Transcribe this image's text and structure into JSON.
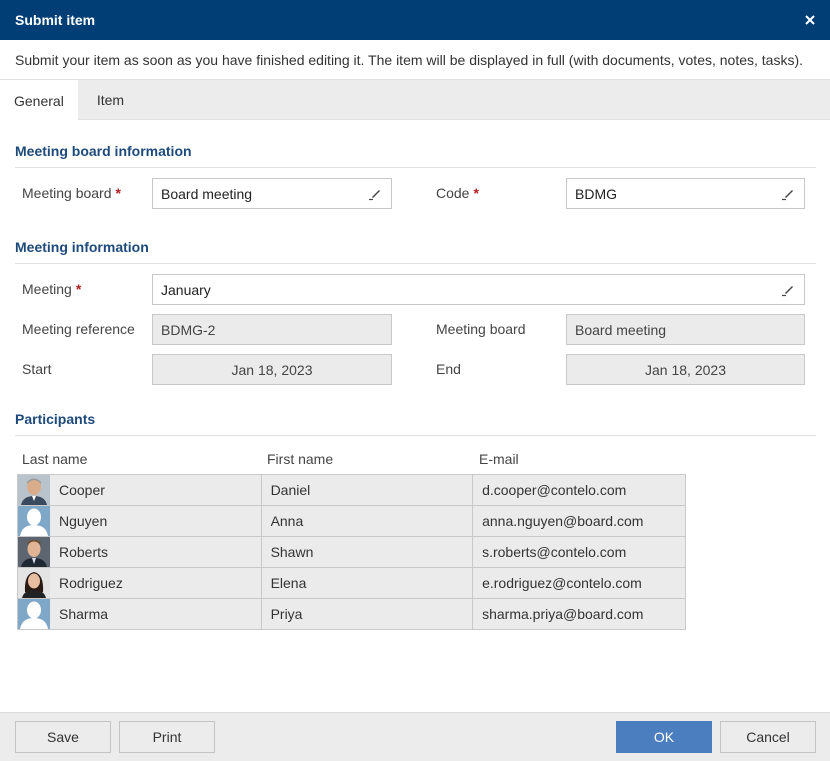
{
  "dialog": {
    "title": "Submit item",
    "intro": "Submit your item as soon as you have finished editing it. The item will be displayed in full (with documents, votes, notes, tasks)."
  },
  "tabs": [
    {
      "label": "General",
      "active": true
    },
    {
      "label": "Item",
      "active": false
    }
  ],
  "sections": {
    "board_info": "Meeting board information",
    "meeting_info": "Meeting information",
    "participants": "Participants"
  },
  "required_marker": "*",
  "fields": {
    "meeting_board": {
      "label": "Meeting board",
      "value": "Board meeting"
    },
    "code": {
      "label": "Code",
      "value": "BDMG"
    },
    "meeting": {
      "label": "Meeting",
      "value": "January"
    },
    "meeting_reference": {
      "label": "Meeting reference",
      "value": "BDMG-2"
    },
    "meeting_board_ro": {
      "label": "Meeting board",
      "value": "Board meeting"
    },
    "start": {
      "label": "Start",
      "value": "Jan 18, 2023"
    },
    "end": {
      "label": "End",
      "value": "Jan 18, 2023"
    }
  },
  "participants": {
    "columns": [
      "Last name",
      "First name",
      "E-mail"
    ],
    "rows": [
      {
        "last": "Cooper",
        "first": "Daniel",
        "email": "d.cooper@contelo.com",
        "avatar": "photo-man-grey-hair"
      },
      {
        "last": "Nguyen",
        "first": "Anna",
        "email": "anna.nguyen@board.com",
        "avatar": "placeholder-silhouette"
      },
      {
        "last": "Roberts",
        "first": "Shawn",
        "email": "s.roberts@contelo.com",
        "avatar": "photo-man-suit"
      },
      {
        "last": "Rodriguez",
        "first": "Elena",
        "email": "e.rodriguez@contelo.com",
        "avatar": "photo-woman-dark-hair"
      },
      {
        "last": "Sharma",
        "first": "Priya",
        "email": "sharma.priya@board.com",
        "avatar": "placeholder-silhouette"
      }
    ]
  },
  "buttons": {
    "save": "Save",
    "print": "Print",
    "ok": "OK",
    "cancel": "Cancel"
  },
  "colors": {
    "titlebar": "#003e75",
    "section_title": "#1d4a7a",
    "primary_button": "#4a7ebf",
    "required": "#b02020"
  }
}
